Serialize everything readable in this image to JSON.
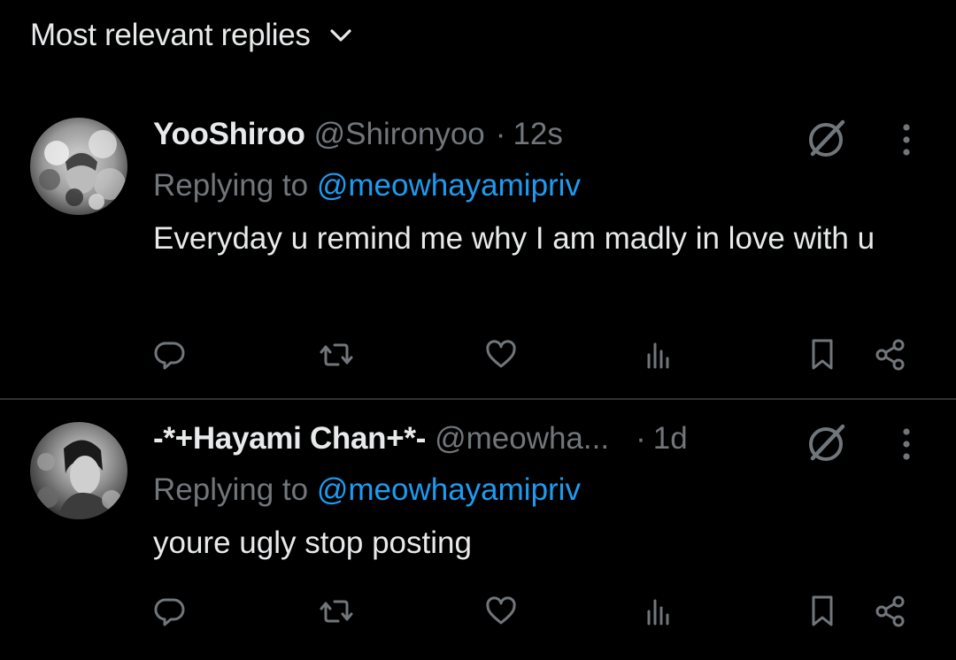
{
  "sort": {
    "label": "Most relevant replies",
    "chevron_icon": "chevron-down-icon"
  },
  "colors": {
    "background": "#000000",
    "primary_text": "#e7e9ea",
    "secondary_text": "#71767b",
    "mention": "#1d9bf0",
    "divider": "#2f3336"
  },
  "replies": [
    {
      "display_name": "YooShiroo",
      "handle": "@Shironyoo",
      "separator": "·",
      "time": "12s",
      "replying_prefix": "Replying to",
      "replying_to": "@meowhayamipriv",
      "text": "Everyday u remind me why I am madly in love with u",
      "icons": [
        "grok-icon",
        "more-icon",
        "reply-icon",
        "repost-icon",
        "like-icon",
        "views-icon",
        "bookmark-icon",
        "share-icon"
      ]
    },
    {
      "display_name": "-*+Hayami Chan+*-",
      "handle": "@meowha...",
      "separator": "·",
      "time": "1d",
      "replying_prefix": "Replying to",
      "replying_to": "@meowhayamipriv",
      "text": "youre ugly stop posting",
      "icons": [
        "grok-icon",
        "more-icon",
        "reply-icon",
        "repost-icon",
        "like-icon",
        "views-icon",
        "bookmark-icon",
        "share-icon"
      ]
    }
  ]
}
